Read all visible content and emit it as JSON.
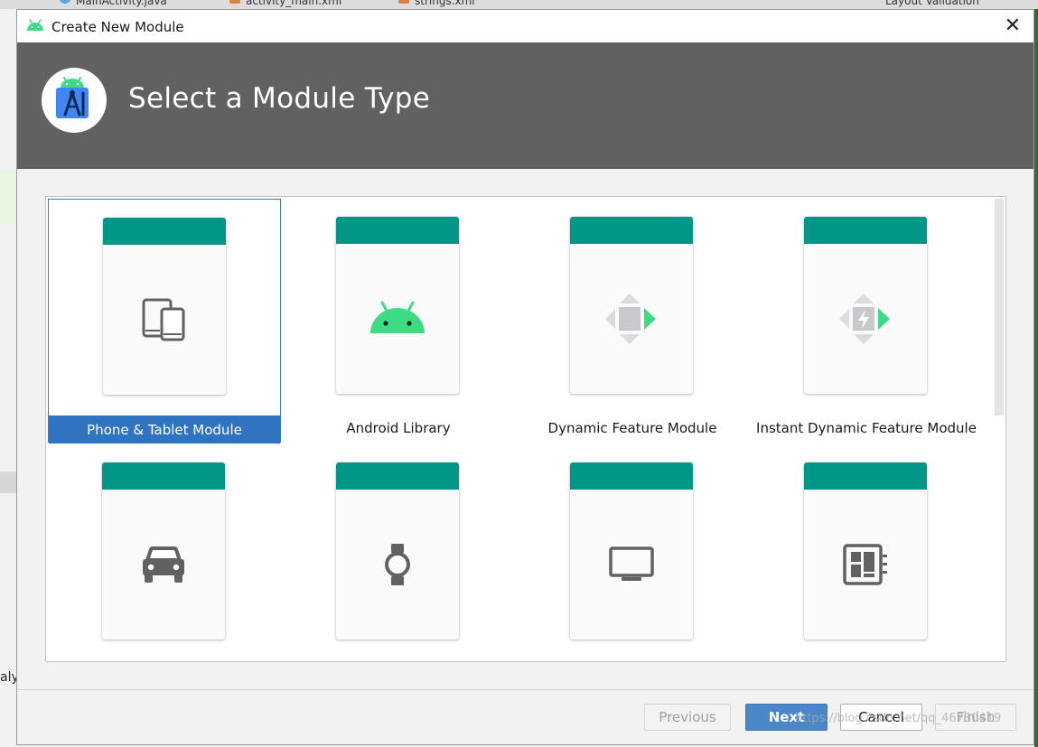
{
  "ide": {
    "tabs": [
      {
        "label": "MainActivity.java",
        "color": "#5aa6d8"
      },
      {
        "label": "activity_main.xml",
        "color": "#e0803a"
      },
      {
        "label": "strings.xml",
        "color": "#e0803a"
      },
      {
        "label": "Layout Validation",
        "color": ""
      }
    ],
    "left_fragment": "aly"
  },
  "dialog": {
    "title": "Create New Module",
    "close_glyph": "✕",
    "header": "Select a Module Type",
    "modules": [
      {
        "label": "Phone & Tablet Module",
        "icon": "phone-tablet-icon",
        "selected": true
      },
      {
        "label": "Android Library",
        "icon": "android-icon",
        "selected": false
      },
      {
        "label": "Dynamic Feature Module",
        "icon": "dynamic-feature-icon",
        "selected": false
      },
      {
        "label": "Instant Dynamic Feature Module",
        "icon": "instant-dynamic-feature-icon",
        "selected": false
      },
      {
        "label": "",
        "icon": "car-icon",
        "selected": false
      },
      {
        "label": "",
        "icon": "watch-icon",
        "selected": false
      },
      {
        "label": "",
        "icon": "tv-icon",
        "selected": false
      },
      {
        "label": "",
        "icon": "things-board-icon",
        "selected": false
      }
    ],
    "buttons": {
      "previous": "Previous",
      "next": "Next",
      "cancel": "Cancel",
      "finish": "Finish"
    },
    "watermark": "https://blog.csdn.net/qq_46730419"
  },
  "colors": {
    "banner": "#616161",
    "card_header": "#009688",
    "selection": "#2e74c0",
    "android_green": "#3ddc84",
    "primary_button": "#4a87c9"
  }
}
